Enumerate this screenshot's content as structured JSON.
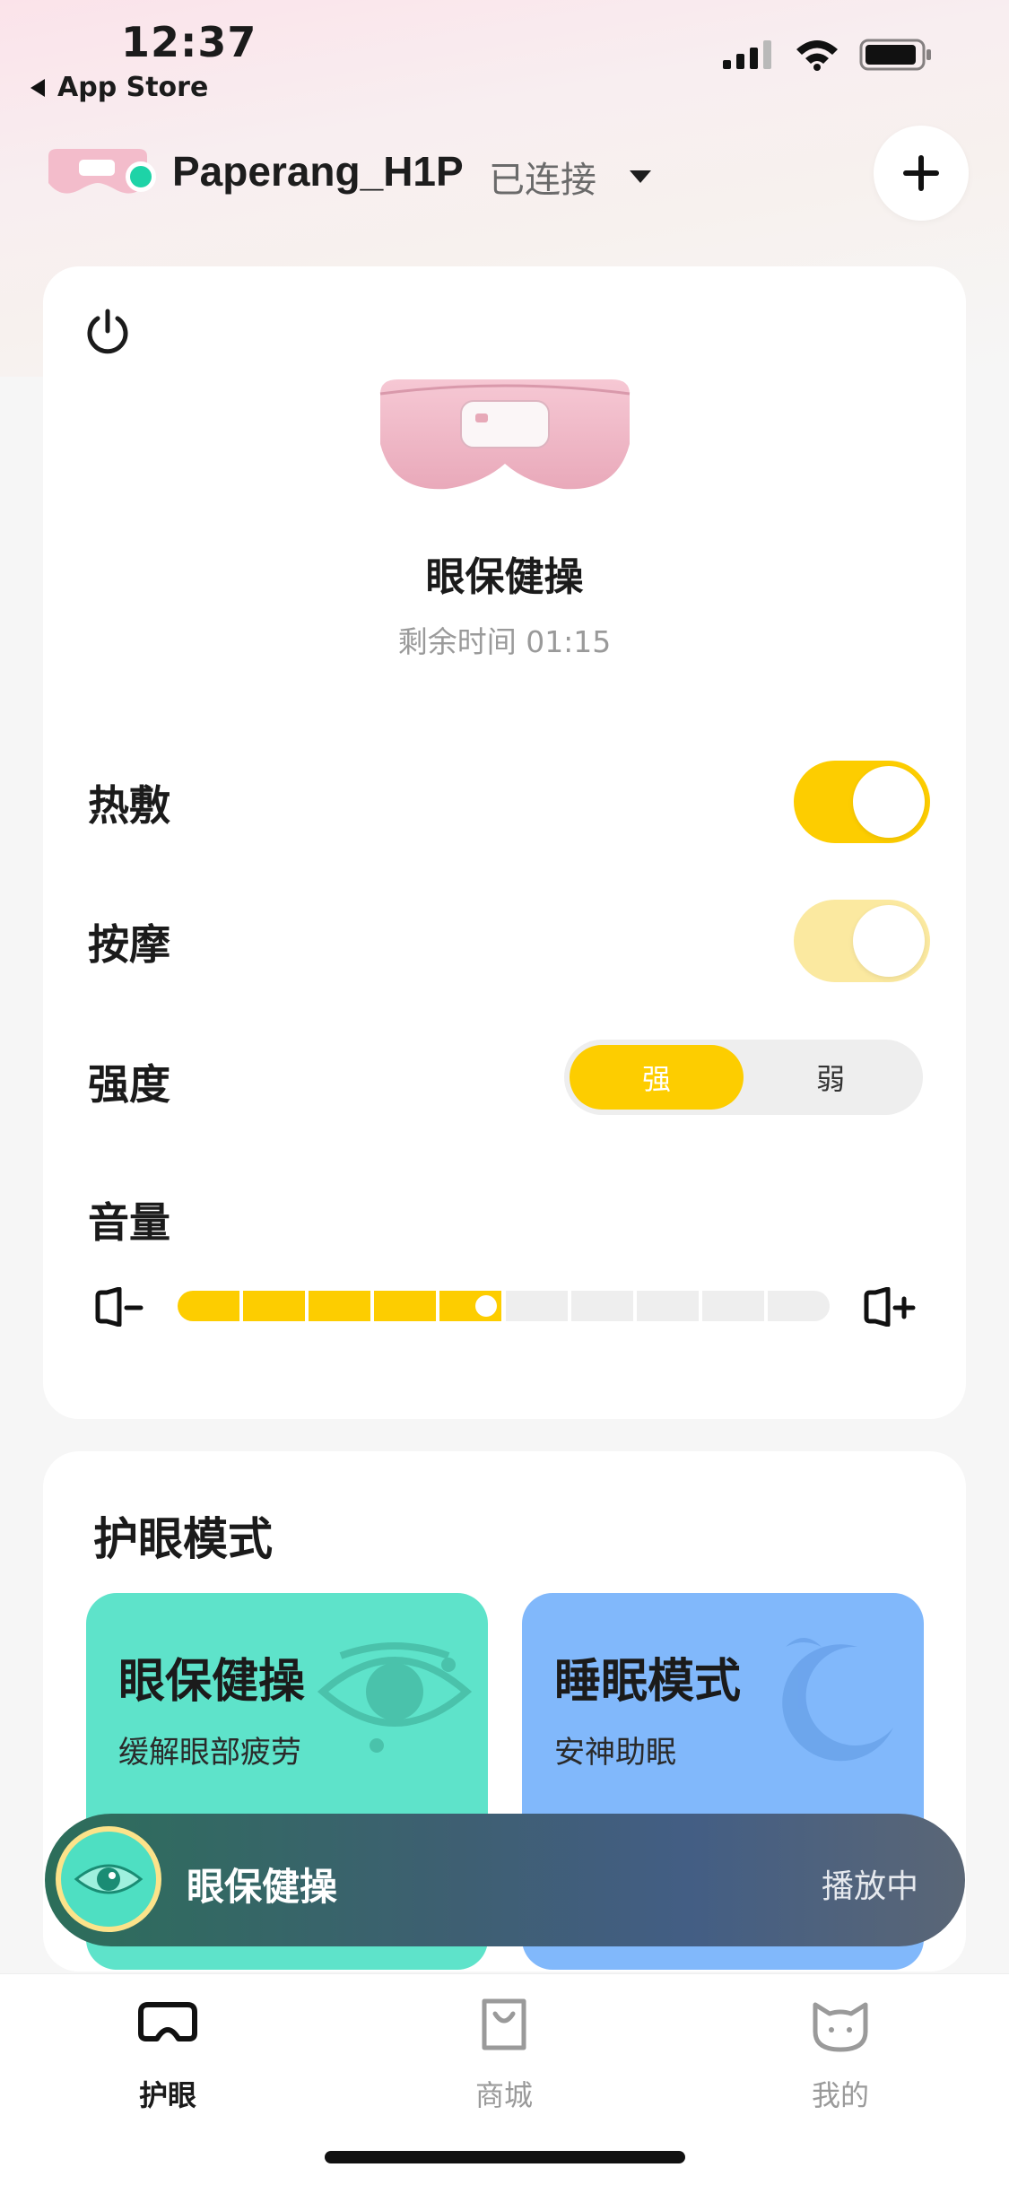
{
  "status_bar": {
    "time": "12:37",
    "back_label": "App Store",
    "icons": [
      "signal-icon",
      "wifi-icon",
      "battery-icon"
    ]
  },
  "header": {
    "device_name": "Paperang_H1P",
    "connection_status": "已连接",
    "icons": [
      "device-thumbnail",
      "chevron-down-icon",
      "plus-icon"
    ]
  },
  "device_card": {
    "current_mode": "眼保健操",
    "remaining_time": "剩余时间 01:15",
    "heat": {
      "label": "热敷",
      "on": true
    },
    "massage": {
      "label": "按摩",
      "on": true,
      "dimmed": true
    },
    "intensity": {
      "label": "强度",
      "options": [
        "强",
        "弱"
      ],
      "selected": "强"
    },
    "volume": {
      "label": "音量",
      "level_fraction": 0.5,
      "segments": 10
    }
  },
  "modes_section": {
    "title": "护眼模式",
    "tiles": [
      {
        "title": "眼保健操",
        "subtitle": "缓解眼部疲劳",
        "color": "#5ee3ca",
        "icon": "eye-icon"
      },
      {
        "title": "睡眠模式",
        "subtitle": "安神助眠",
        "color": "#81b8fb",
        "icon": "moon-icon"
      }
    ]
  },
  "now_playing": {
    "title": "眼保健操",
    "status": "播放中"
  },
  "tabbar": {
    "tabs": [
      {
        "label": "护眼",
        "icon": "eye-mask-icon",
        "active": true
      },
      {
        "label": "商城",
        "icon": "shopping-bag-icon",
        "active": false
      },
      {
        "label": "我的",
        "icon": "cat-face-icon",
        "active": false
      }
    ]
  },
  "colors": {
    "accent_yellow": "#fdcd00",
    "online_green": "#1ed3a7",
    "mint_tile": "#5ee3ca",
    "blue_tile": "#81b8fb"
  }
}
